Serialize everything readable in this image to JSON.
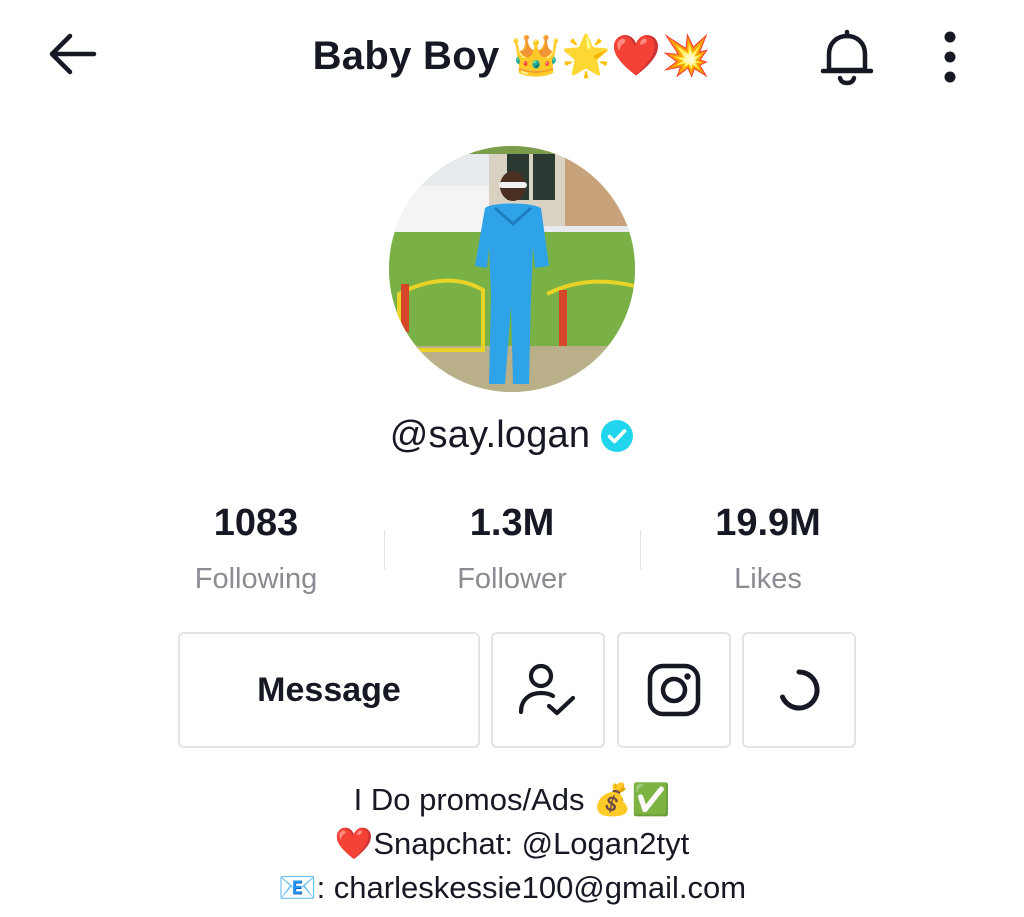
{
  "header": {
    "title": "Baby Boy",
    "title_emojis": "👑🌟❤️💥",
    "icons": [
      "back-arrow-icon",
      "bell-icon",
      "more-vertical-icon"
    ]
  },
  "profile": {
    "username": "@say.logan",
    "verified": true,
    "accent_color": "#20d5ec"
  },
  "stats": [
    {
      "value": "1083",
      "label": "Following"
    },
    {
      "value": "1.3M",
      "label": "Follower"
    },
    {
      "value": "19.9M",
      "label": "Likes"
    }
  ],
  "actions": {
    "message_label": "Message",
    "icons": [
      "following-check-icon",
      "instagram-icon",
      "loading-spinner-icon"
    ]
  },
  "bio": {
    "line1_text": "I Do promos/Ads ",
    "line1_emoji": "💰✅",
    "line2_emoji": "❤️",
    "line2_text": "Snapchat: @Logan2tyt",
    "line3_emoji": "📧",
    "line3_text": ": charleskessie100@gmail.com"
  }
}
